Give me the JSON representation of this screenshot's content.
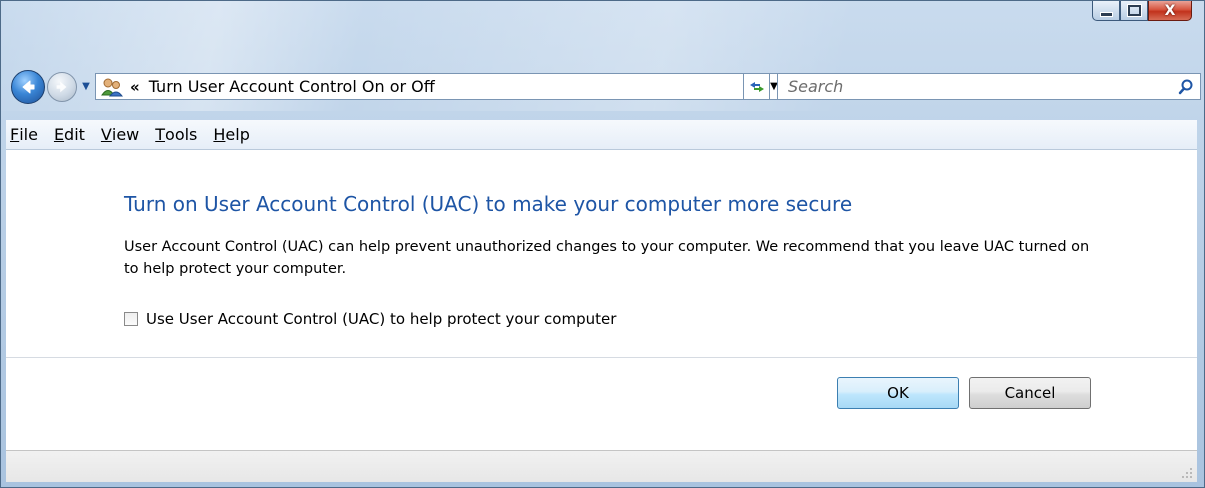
{
  "window": {
    "caption_buttons": {
      "minimize": "minimize-icon",
      "maximize": "maximize-icon",
      "close": "close-icon"
    },
    "close_glyph": "X"
  },
  "navigation": {
    "back_icon": "back-arrow-icon",
    "forward_icon": "forward-arrow-icon",
    "recent_pages_icon": "chevron-down-icon",
    "address": {
      "icon": "user-accounts-icon",
      "overflow_chevron": "«",
      "path": "Turn User Account Control On or Off",
      "dropdown_icon": "chevron-down-icon"
    },
    "refresh_icon": "refresh-icon",
    "search": {
      "placeholder": "Search",
      "value": "",
      "icon": "search-icon"
    }
  },
  "menubar": {
    "items": [
      {
        "label": "File",
        "accel": "F",
        "rest": "ile"
      },
      {
        "label": "Edit",
        "accel": "E",
        "rest": "dit"
      },
      {
        "label": "View",
        "accel": "V",
        "rest": "iew"
      },
      {
        "label": "Tools",
        "accel": "T",
        "rest": "ools"
      },
      {
        "label": "Help",
        "accel": "H",
        "rest": "elp"
      }
    ]
  },
  "main": {
    "heading": "Turn on User Account Control (UAC) to make your computer more secure",
    "description": "User Account Control (UAC) can help prevent unauthorized changes to your computer.  We recommend that you leave UAC turned on to help protect your computer.",
    "checkbox": {
      "label": "Use User Account Control (UAC) to help protect your computer",
      "checked": false
    },
    "buttons": {
      "ok": "OK",
      "cancel": "Cancel"
    }
  },
  "colors": {
    "heading": "#1e55a5",
    "accent": "#3c7fb1"
  }
}
